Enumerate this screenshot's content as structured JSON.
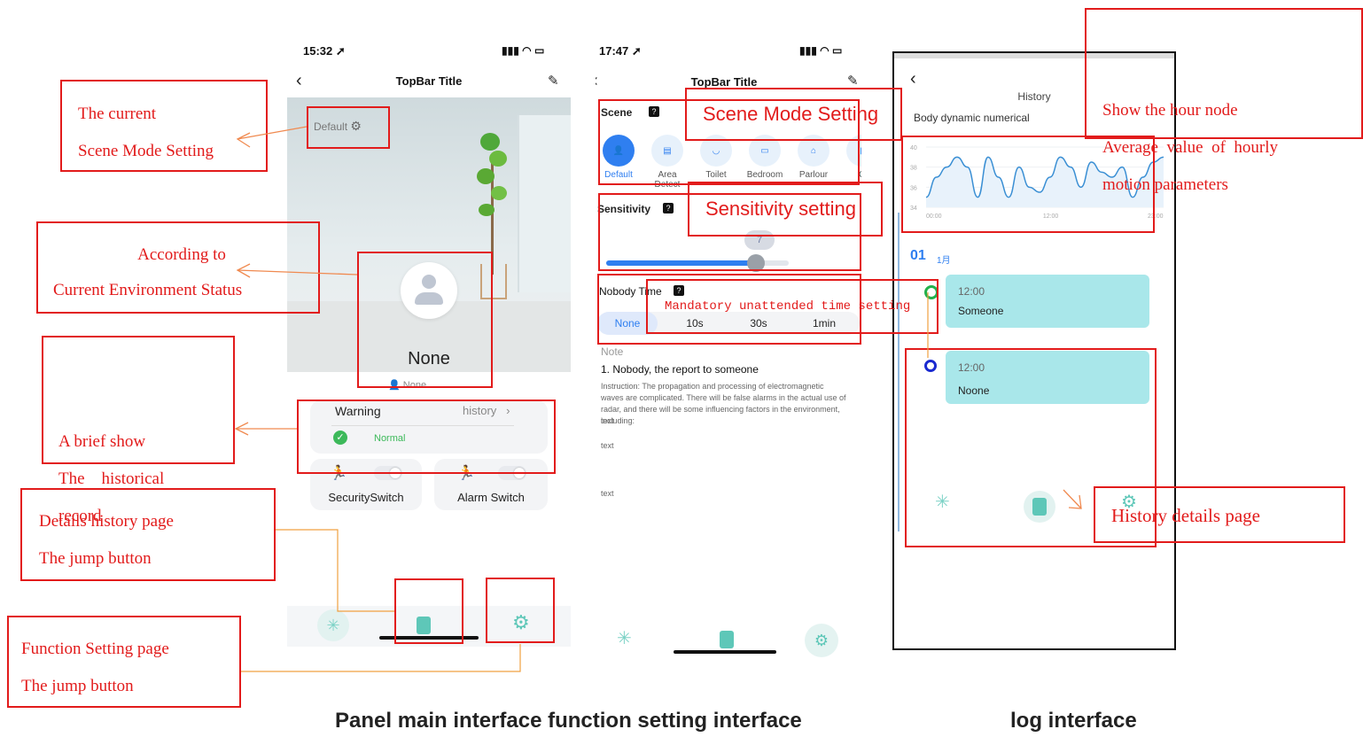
{
  "phone1": {
    "time": "15:32",
    "title": "TopBar Title",
    "scene_chip": "Default",
    "status_name": "None",
    "status_sub": "None",
    "warning_label": "Warning",
    "history_link": "history",
    "normal_label": "Normal",
    "security_switch": "SecuritySwitch",
    "alarm_switch": "Alarm Switch"
  },
  "phone2": {
    "time": "17:47",
    "title": "TopBar Title",
    "scene_label": "Scene",
    "scenes": [
      "Default",
      "Area Detect",
      "Toilet",
      "Bedroom",
      "Parlour",
      "O"
    ],
    "sensitivity_label": "Sensitivity",
    "sensitivity_value": "7",
    "sensitivity_level": 0.82,
    "nobody_time_label": "Nobody Time",
    "nobody_options": [
      "None",
      "10s",
      "30s",
      "1min"
    ],
    "note_label": "Note",
    "note_heading": "1. Nobody, the report to someone",
    "note_body": "Instruction: The propagation and processing of electromagnetic waves are complicated. There will be false alarms in the actual use of radar, and there will be some influencing factors in the environment, including:",
    "text1": "text",
    "text2": "text",
    "text3": "text"
  },
  "phone3": {
    "title": "History",
    "subtitle": "Body dynamic numerical",
    "y_ticks": [
      "40",
      "38",
      "36",
      "34"
    ],
    "x_ticks": [
      "00:00",
      "12:00",
      "23:00"
    ],
    "date_day": "01",
    "date_month": "1月",
    "entries": [
      {
        "time": "12:00",
        "status": "Someone"
      },
      {
        "time": "12:00",
        "status": "Noone"
      }
    ]
  },
  "chart_data": {
    "type": "line",
    "x": [
      0,
      1,
      2,
      3,
      4,
      5,
      6,
      7,
      8,
      9,
      10,
      11,
      12,
      13,
      14,
      15,
      16,
      17,
      18,
      19,
      20,
      21,
      22,
      23
    ],
    "values": [
      35,
      37,
      38,
      39,
      38,
      35,
      39,
      37,
      35,
      38,
      36,
      35.5,
      37,
      39,
      38,
      36,
      38.5,
      37.5,
      37,
      38,
      35,
      37,
      38.5,
      39
    ],
    "ylim": [
      34,
      40
    ],
    "ticks_y": [
      "40",
      "38",
      "36",
      "34"
    ],
    "ticks_x": [
      "00:00",
      "12:00",
      "23:00"
    ],
    "color": "#3a8fd4"
  },
  "annotations": {
    "scene_current": [
      "The current",
      "Scene Mode Setting"
    ],
    "env_status": [
      "According to",
      "Current Environment Status"
    ],
    "brief_history": [
      "A brief show",
      "The    historical",
      "record"
    ],
    "details_button": [
      "Details history page",
      "The jump button"
    ],
    "function_button": [
      "Function Setting page",
      "The jump button"
    ],
    "scene_mode_setting": "Scene Mode Setting",
    "sensitivity_setting": "Sensitivity setting",
    "mandatory_time": "Mandatory unattended time setting",
    "hour_node": [
      "Show the hour node",
      "Average  value  of  hourly",
      "motion parameters"
    ],
    "history_details": "History details page"
  },
  "captions": {
    "main": "Panel main interface function setting interface",
    "log": "log interface"
  },
  "colors": {
    "annotation_red": "#e21b1b",
    "accent_blue": "#2f7ff0",
    "history_card": "#a9e7ea",
    "arrow_orange": "#f08a50"
  }
}
